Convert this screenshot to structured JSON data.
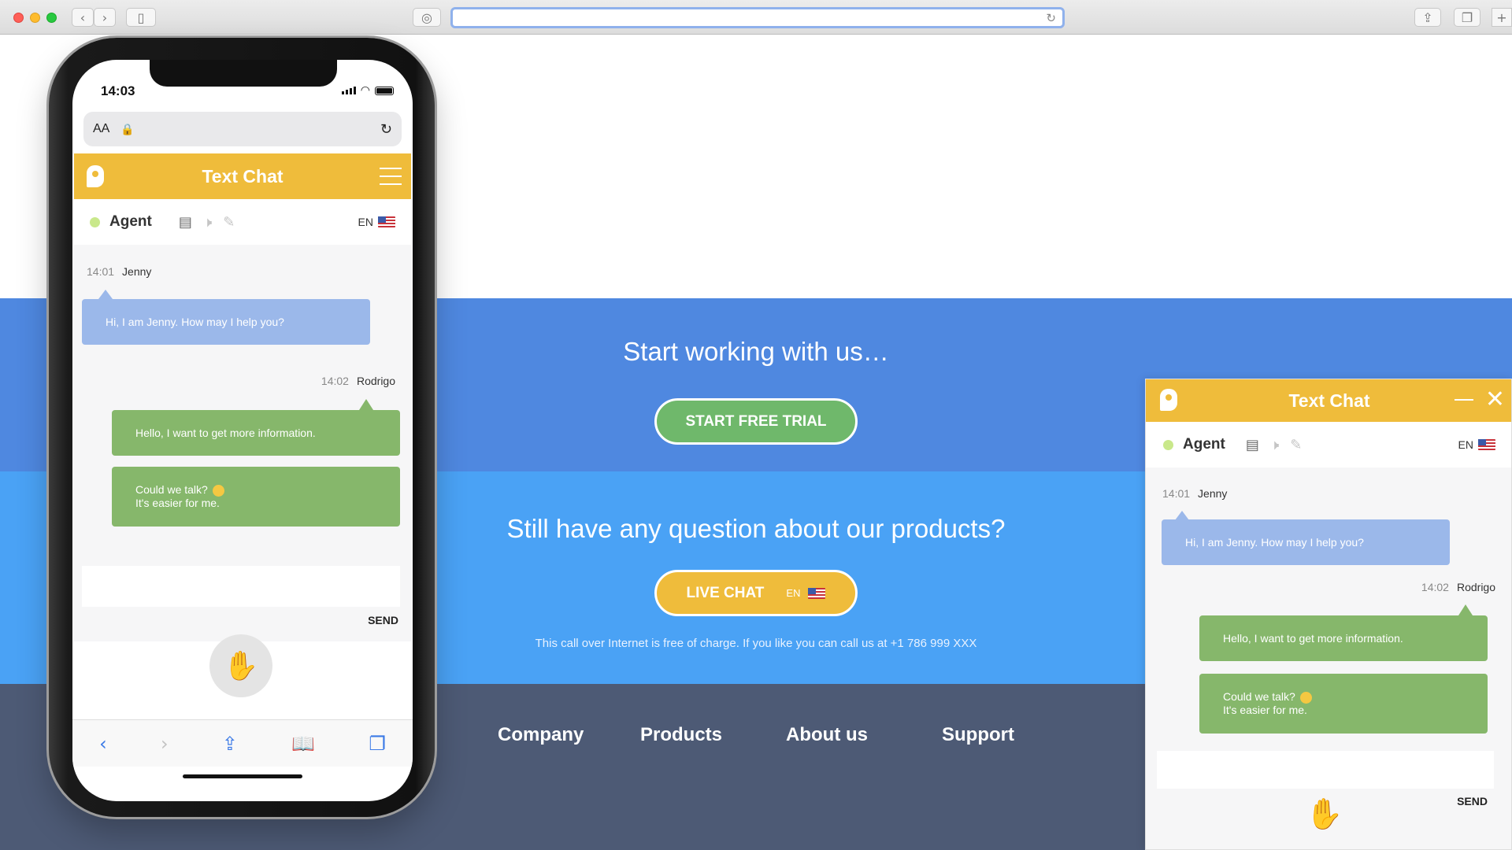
{
  "browser": {
    "reader_icon": "reader-icon",
    "back_icon": "chevron-left-icon",
    "forward_icon": "chevron-right-icon",
    "sidebar_icon": "sidebar-icon",
    "share_icon": "share-icon",
    "tabs_icon": "tabs-icon",
    "new_tab_icon": "plus-icon",
    "reload_icon": "reload-icon"
  },
  "page": {
    "cta1_heading": "Start working with us…",
    "cta1_button": "START FREE TRIAL",
    "cta2_heading": "Still have any question about our products?",
    "cta2_button": "LIVE CHAT",
    "cta2_lang": "EN",
    "note": "This call over Internet is free of charge. If you like you can call us at +1 786 999 XXX",
    "footer_links": [
      "Company",
      "Products",
      "About us",
      "Support"
    ],
    "colors": {
      "band1": "#4f88e0",
      "band2": "#4aa2f5",
      "footer": "#4d5a75",
      "accent": "#efbc3b",
      "green": "#6fb86b"
    }
  },
  "phone": {
    "time": "14:03",
    "url_aa": "AA",
    "chat": {
      "title": "Text Chat",
      "agent": "Agent",
      "lang": "EN",
      "messages": [
        {
          "time": "14:01",
          "sender": "Jenny",
          "text": "Hi, I am Jenny. How may I help you?"
        },
        {
          "time": "14:02",
          "sender": "Rodrigo",
          "text": "Hello, I want to get more information.",
          "text2a": "Could we talk?",
          "text2b": "It's easier for me."
        }
      ],
      "send": "SEND"
    }
  },
  "widget": {
    "title": "Text Chat",
    "agent": "Agent",
    "lang": "EN",
    "messages": [
      {
        "time": "14:01",
        "sender": "Jenny",
        "text": "Hi, I am Jenny. How may I help you?"
      },
      {
        "time": "14:02",
        "sender": "Rodrigo",
        "text": "Hello, I want to get more information.",
        "text2a": "Could we talk?",
        "text2b": "It's easier for me."
      }
    ],
    "send": "SEND"
  }
}
